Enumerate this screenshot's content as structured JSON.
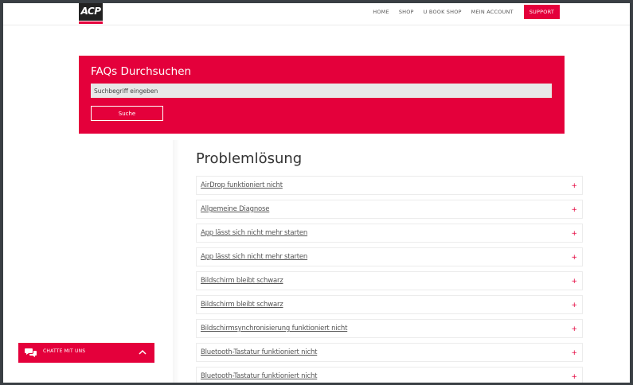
{
  "header": {
    "logo_text": "ACP",
    "nav": [
      "HOME",
      "SHOP",
      "U BOOK SHOP",
      "MEIN ACCOUNT"
    ],
    "support_label": "SUPPORT"
  },
  "search": {
    "title": "FAQs Durchsuchen",
    "placeholder": "Suchbegriff eingeben",
    "button_label": "Suche"
  },
  "section": {
    "title": "Problemlösung",
    "toggle_symbol": "+",
    "items": [
      "AirDrop funktioniert nicht",
      "Allgemeine Diagnose",
      "App lässt sich nicht mehr starten",
      "App lässt sich nicht mehr starten",
      "Bildschirm bleibt schwarz",
      "Bildschirm bleibt schwarz",
      "Bildschirmsynchronisierung funktioniert nicht",
      "Bluetooth-Tastatur funktioniert nicht",
      "Bluetooth-Tastatur funktioniert nicht"
    ]
  },
  "chat": {
    "label": "CHATTE MIT UNS",
    "icon": "chat-bubbles-icon"
  },
  "colors": {
    "accent": "#e4003b",
    "background": "#ffffff"
  }
}
